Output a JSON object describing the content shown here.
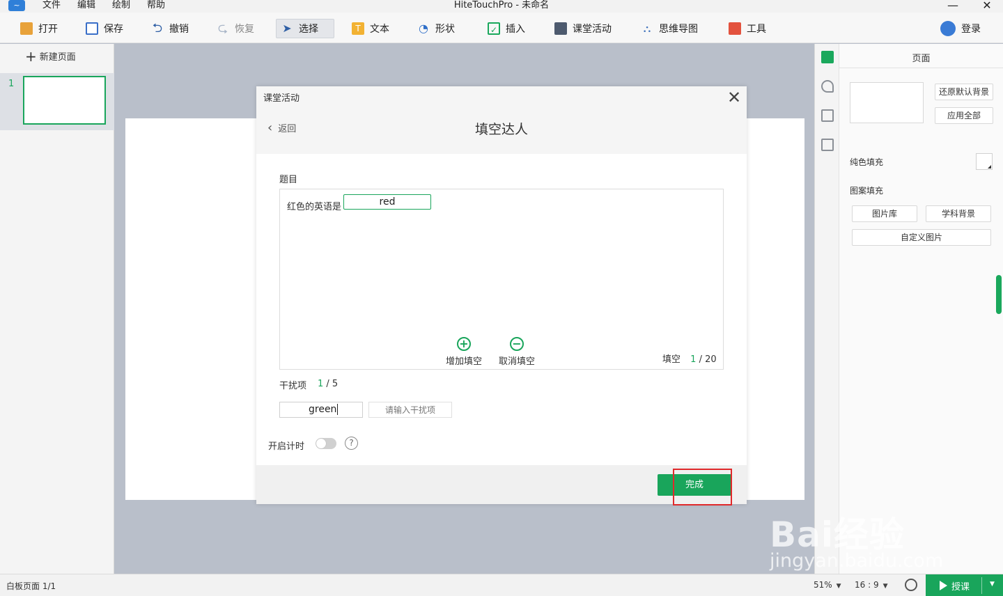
{
  "app": {
    "title": "HiteTouchPro - 未命名",
    "menu": [
      "文件",
      "编辑",
      "绘制",
      "帮助"
    ]
  },
  "toolbar": {
    "open": "打开",
    "save": "保存",
    "undo": "撤销",
    "redo": "恢复",
    "select": "选择",
    "text": "文本",
    "shape": "形状",
    "insert": "插入",
    "activity": "课堂活动",
    "mindmap": "思维导图",
    "tools": "工具",
    "login": "登录"
  },
  "pages": {
    "new_page": "新建页面",
    "items": [
      {
        "number": "1"
      }
    ]
  },
  "right_panel": {
    "title": "页面",
    "restore_bg": "还原默认背景",
    "apply_all": "应用全部",
    "solid_fill": "纯色填充",
    "pattern_fill": "图案填充",
    "gallery": "图片库",
    "subject_bg": "学科背景",
    "custom_image": "自定义图片"
  },
  "modal": {
    "caption": "课堂活动",
    "back": "返回",
    "title": "填空达人",
    "question_label": "题目",
    "question_prefix": "红色的英语是",
    "blank_value": "red",
    "add_blank": "增加填空",
    "remove_blank": "取消填空",
    "fill_label": "填空",
    "fill_current": "1",
    "fill_total": "/ 20",
    "distractor_label": "干扰项",
    "distractor_current": "1",
    "distractor_total": "/ 5",
    "distractor_value": "green",
    "distractor_placeholder": "请输入干扰项",
    "timer_label": "开启计时",
    "timer_on": false,
    "done": "完成"
  },
  "status": {
    "page_info": "白板页面 1/1",
    "zoom": "51%",
    "ratio": "16 : 9",
    "teach": "授课"
  },
  "watermark": {
    "line1": "Bai经验",
    "line2": "jingyan.baidu.com"
  },
  "colors": {
    "accent": "#19a55b",
    "highlight": "#e0292b"
  }
}
